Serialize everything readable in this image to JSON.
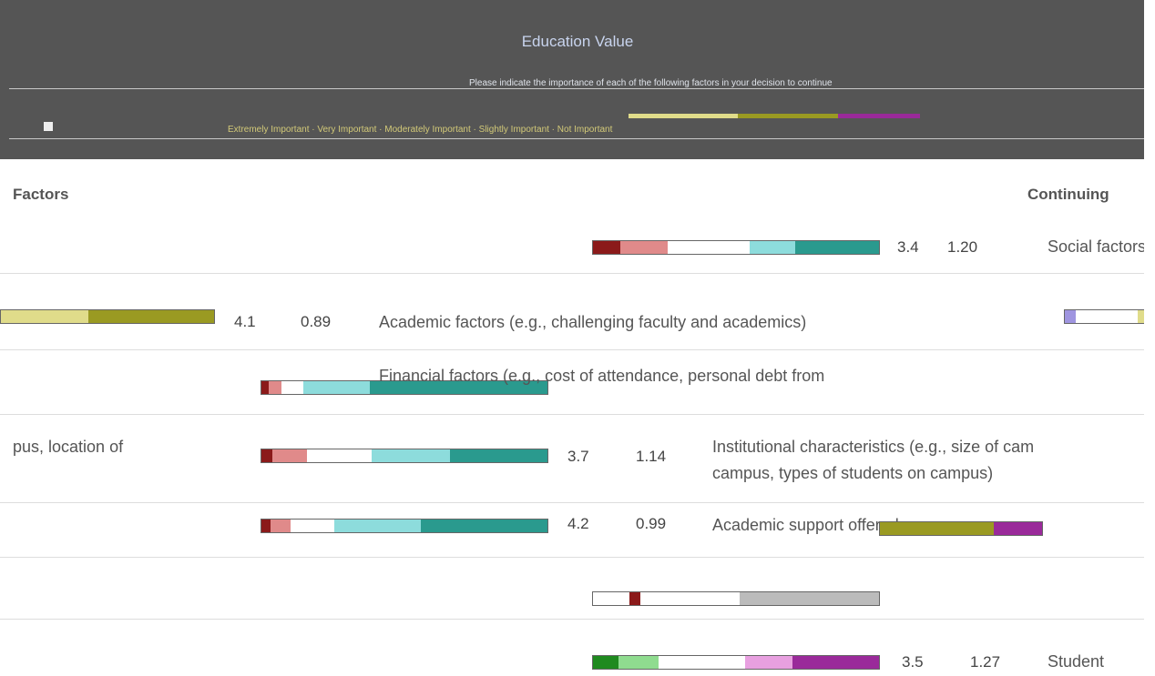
{
  "header": {
    "title": "Education Value",
    "subtitle": "Please indicate the importance of each of the following factors in your decision to continue",
    "legend": "Extremely Important · Very Important · Moderately Important · Slightly Important · Not Important"
  },
  "columns": {
    "factors": "Factors",
    "continuing": "Continuing"
  },
  "rows": [
    {
      "mean": "3.4",
      "sd": "1.20",
      "label_left": "",
      "label_right": "Social factors"
    },
    {
      "mean": "4.1",
      "sd": "0.89",
      "label_left": "",
      "label_right": "Academic factors (e.g., challenging faculty and academics)"
    },
    {
      "mean": "",
      "sd": "",
      "label_left": "",
      "label_right": "Financial factors (e.g., cost of attendance, personal debt from"
    },
    {
      "mean": "3.7",
      "sd": "1.14",
      "label_left": "pus, location of",
      "label_right_1": "Institutional characteristics (e.g., size of cam",
      "label_right_2": "campus, types of students on campus)"
    },
    {
      "mean": "4.2",
      "sd": "0.99",
      "label_left": "",
      "label_right": "Academic support offered"
    },
    {
      "mean": "3.5",
      "sd": "1.27",
      "label_left": "",
      "label_right": "Student"
    }
  ],
  "colors": {
    "dark_red": "#8b1a1a",
    "salmon": "#e08a8a",
    "light_teal": "#8ddcdc",
    "teal": "#2a9a8e",
    "khaki": "#e0dc8a",
    "olive": "#9a9a22",
    "lavender": "#9f95e0",
    "green": "#1f8a1f",
    "light_green": "#8fdc8f",
    "pink": "#e8a0e0",
    "purple": "#9a2a9a"
  }
}
